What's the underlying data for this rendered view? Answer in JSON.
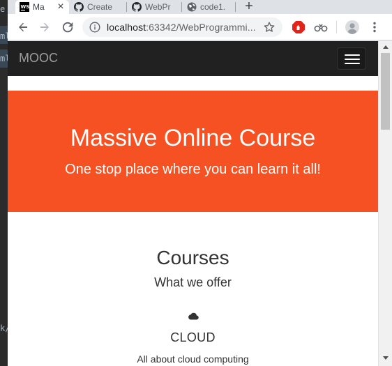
{
  "ide": {
    "fragments": [
      "e",
      "ml",
      "ml",
      "k/"
    ]
  },
  "browser": {
    "tabs": [
      {
        "label": "Ma",
        "icon": "webstorm-icon",
        "active": true
      },
      {
        "label": "Create",
        "icon": "github-icon",
        "active": false
      },
      {
        "label": "WebPr",
        "icon": "github-icon",
        "active": false
      },
      {
        "label": "code1.",
        "icon": "globe-icon",
        "active": false
      }
    ],
    "new_tab": "+",
    "close_glyph": "×",
    "address": {
      "host": "localhost",
      "rest": ":63342/WebProgrammi..."
    }
  },
  "page": {
    "brand": "MOOC",
    "hero": {
      "title": "Massive Online Course",
      "subtitle": "One stop place where you can learn it all!"
    },
    "courses": {
      "title": "Courses",
      "subtitle": "What we offer",
      "items": [
        {
          "icon": "cloud-icon",
          "title": "CLOUD",
          "description": "All about cloud computing"
        }
      ]
    }
  },
  "colors": {
    "hero_bg": "#f55122",
    "navbar_bg": "#212121",
    "adblock_red": "#e2231a"
  }
}
